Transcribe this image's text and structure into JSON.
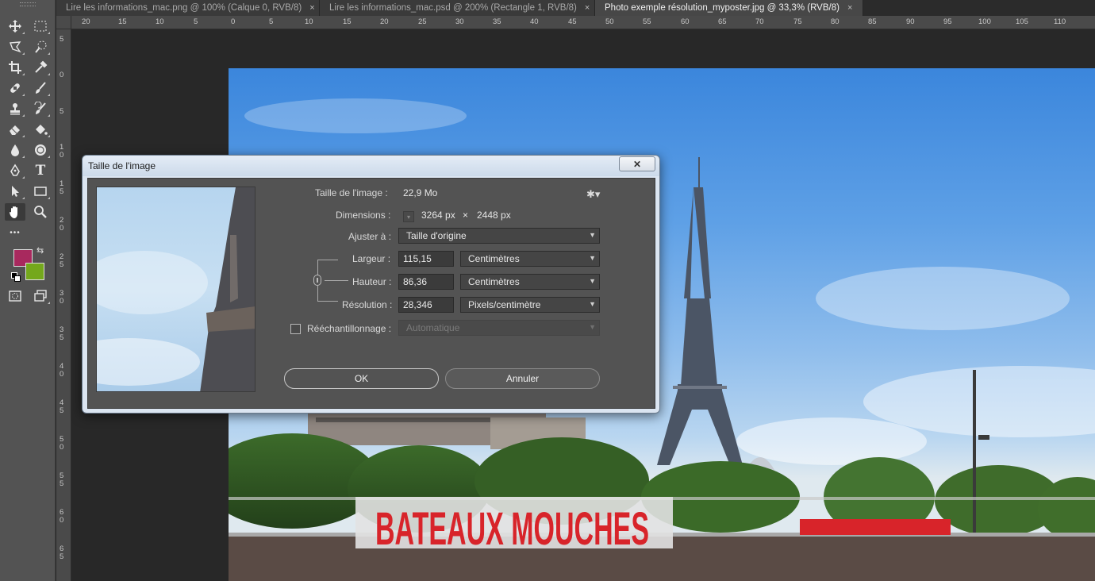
{
  "tabs": [
    {
      "label": "Lire les informations_mac.png @ 100% (Calque 0, RVB/8)",
      "close": "×"
    },
    {
      "label": "Lire les informations_mac.psd @ 200% (Rectangle 1, RVB/8)",
      "close": "×"
    },
    {
      "label": "Photo exemple résolution_myposter.jpg @ 33,3% (RVB/8)",
      "close": "×"
    }
  ],
  "toolbar": {
    "tools": [
      "move-tool",
      "marquee-tool",
      "lasso-tool",
      "quick-selection-tool",
      "crop-tool",
      "eyedropper-tool",
      "healing-brush-tool",
      "brush-tool",
      "clone-stamp-tool",
      "history-brush-tool",
      "eraser-tool",
      "paint-bucket-tool",
      "blur-tool",
      "dodge-tool",
      "pen-tool",
      "type-tool",
      "path-selection-tool",
      "rectangle-tool",
      "hand-tool",
      "zoom-tool",
      "more-tools",
      "edit-toolbar"
    ],
    "foreground_color": "#a8295e",
    "background_color": "#74a81c",
    "type_glyph": "T",
    "more_glyph": "•••"
  },
  "ruler": {
    "h_labels": [
      "20",
      "15",
      "10",
      "5",
      "0",
      "5",
      "10",
      "15",
      "20",
      "25",
      "30",
      "35",
      "40",
      "45",
      "50",
      "55",
      "60",
      "65",
      "70",
      "75",
      "80",
      "85",
      "90",
      "95",
      "100",
      "105",
      "110"
    ],
    "v_labels": [
      "5",
      "0",
      "5",
      "1 0",
      "1 5",
      "2 0",
      "2 5",
      "3 0",
      "3 5",
      "4 0",
      "4 5",
      "5 0",
      "5 5",
      "6 0",
      "6 5"
    ]
  },
  "dialog": {
    "title": "Taille de l'image",
    "close_symbol": "✕",
    "image_size_label": "Taille de l'image :",
    "image_size_value": "22,9 Mo",
    "dimensions_label": "Dimensions :",
    "dimensions_width": "3264 px",
    "dimensions_times": "×",
    "dimensions_height": "2448 px",
    "fit_label": "Ajuster à :",
    "fit_value": "Taille d'origine",
    "width_label": "Largeur :",
    "width_value": "115,15",
    "width_unit": "Centimètres",
    "height_label": "Hauteur :",
    "height_value": "86,36",
    "height_unit": "Centimètres",
    "resolution_label": "Résolution :",
    "resolution_value": "28,346",
    "resolution_unit": "Pixels/centimètre",
    "resample_label": "Rééchantillonnage :",
    "resample_checked": false,
    "resample_value": "Automatique",
    "ok_label": "OK",
    "cancel_label": "Annuler",
    "gear_glyph": "✱▾"
  },
  "photo": {
    "sign_text": "BATEAUX MOUCHES",
    "sky_color": "#4f93e0"
  }
}
